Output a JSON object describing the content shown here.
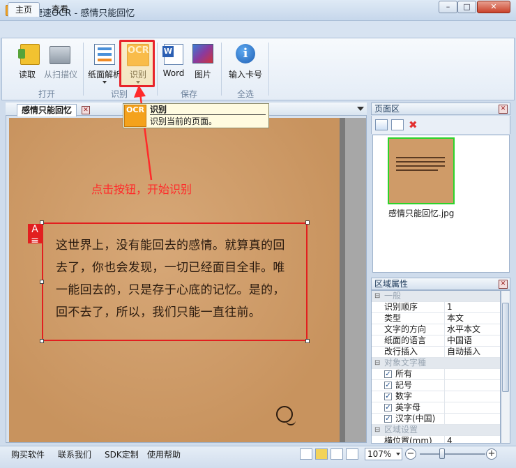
{
  "window": {
    "title": "捷速OCR - 感情只能回忆",
    "min": "–",
    "max": "□",
    "close": "✕"
  },
  "tabs": [
    {
      "label": "主页"
    },
    {
      "label": "查看"
    }
  ],
  "ribbon": {
    "groups": [
      {
        "label": "打开",
        "buttons": [
          {
            "label": "读取",
            "icon": "folder-open-icon"
          },
          {
            "label": "从扫描仪",
            "icon": "scanner-icon"
          }
        ]
      },
      {
        "label": "识别",
        "buttons": [
          {
            "label": "纸面解析",
            "icon": "layout-analysis-icon"
          },
          {
            "label": "识别",
            "icon": "ocr-icon",
            "icon_text": "OCR"
          }
        ]
      },
      {
        "label": "保存",
        "buttons": [
          {
            "label": "Word",
            "icon": "word-icon"
          },
          {
            "label": "图片",
            "icon": "image-icon"
          }
        ]
      },
      {
        "label": "全选",
        "buttons": [
          {
            "label": "输入卡号",
            "icon": "info-icon",
            "icon_text": "i"
          }
        ]
      }
    ]
  },
  "tooltip": {
    "title": "识别",
    "description": "识别当前的页面。",
    "icon_text": "OCR"
  },
  "annotation": "点击按钮，开始识别",
  "document": {
    "tab_label": "感情只能回忆",
    "tab_close": "✕",
    "region_tag": "A",
    "text_lines": [
      "这世界上，没有能回去的感情。就算真的回",
      "去了，你也会发现，一切已经面目全非。唯",
      "一能回去的，只是存于心底的记忆。是的，",
      "回不去了，所以，我们只能一直往前。"
    ]
  },
  "page_panel": {
    "title": "页面区",
    "close": "✕",
    "delete_icon": "✖",
    "thumbnail_name": "感情只能回忆.jpg"
  },
  "region_panel": {
    "title": "区域属性",
    "close": "✕",
    "rows": [
      {
        "type": "category",
        "name": "一般",
        "toggle": "⊟"
      },
      {
        "type": "prop",
        "name": "识别顺序",
        "value": "1"
      },
      {
        "type": "prop",
        "name": "类型",
        "value": "本文"
      },
      {
        "type": "prop",
        "name": "文字的方向",
        "value": "水平本文"
      },
      {
        "type": "prop",
        "name": "纸面的语言",
        "value": "中国语"
      },
      {
        "type": "prop",
        "name": "改行插入",
        "value": "自动插入"
      },
      {
        "type": "category",
        "name": "对象文字種",
        "toggle": "⊟"
      },
      {
        "type": "check",
        "name": "所有",
        "checked": "✓"
      },
      {
        "type": "check",
        "name": "記号",
        "checked": "✓"
      },
      {
        "type": "check",
        "name": "数字",
        "checked": "✓"
      },
      {
        "type": "check",
        "name": "英字母",
        "checked": "✓"
      },
      {
        "type": "check",
        "name": "汉字(中国)",
        "checked": "✓"
      },
      {
        "type": "category",
        "name": "区域设置",
        "toggle": "⊟"
      },
      {
        "type": "prop",
        "name": "横位置(mm)",
        "value": "4"
      }
    ]
  },
  "statusbar": {
    "links": [
      "购买软件",
      "联系我们",
      "SDK定制",
      "使用帮助"
    ],
    "zoom": "107%",
    "zoom_out": "−",
    "zoom_in": "+",
    "zoom_level": 0.34
  },
  "colors": {
    "accent_red": "#e21f1f",
    "thumb_border": "#2bd42b",
    "ocr_orange": "#f4a21c"
  }
}
